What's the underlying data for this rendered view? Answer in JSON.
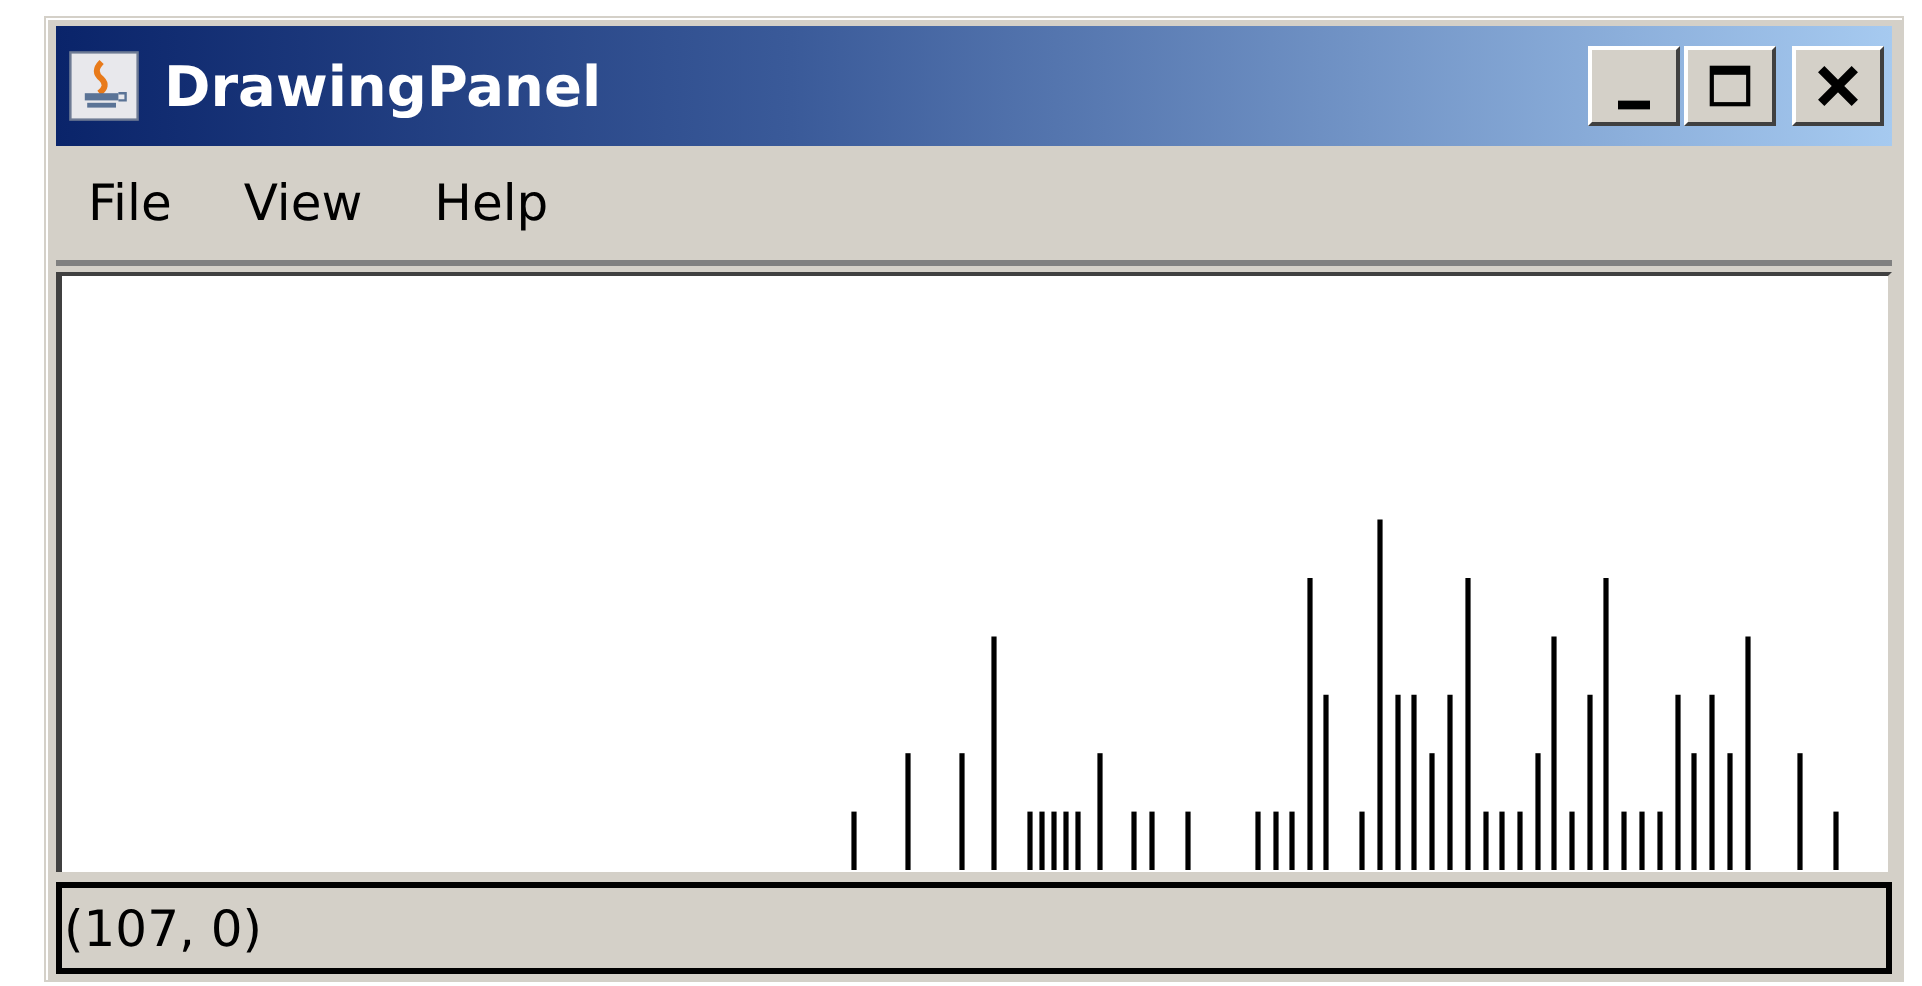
{
  "window": {
    "title": "DrawingPanel"
  },
  "menu": [
    "File",
    "View",
    "Help"
  ],
  "canvas": {
    "kind": "lines"
  },
  "status_bar": {
    "text": "(107, 0)"
  }
}
